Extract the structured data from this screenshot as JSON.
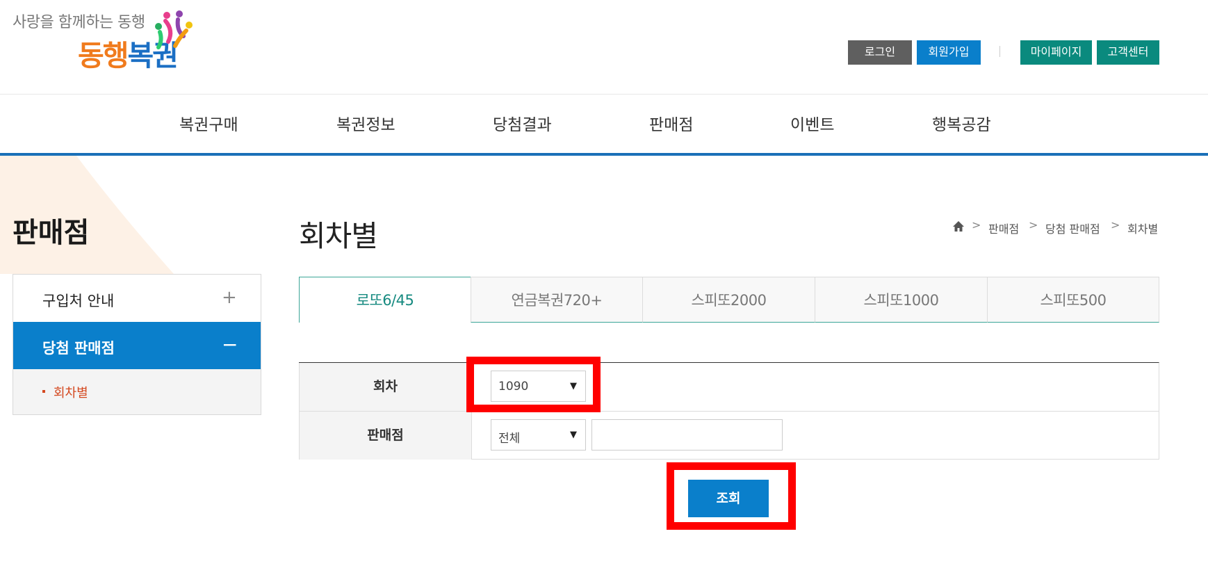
{
  "header": {
    "logo": {
      "slogan": "사랑을 함께하는 동행",
      "name_part1": "동행",
      "name_part2": "복권"
    },
    "buttons": {
      "login": "로그인",
      "join": "회원가입",
      "mypage": "마이페이지",
      "customer_center": "고객센터"
    }
  },
  "gnb": [
    "복권구매",
    "복권정보",
    "당첨결과",
    "판매점",
    "이벤트",
    "행복공감"
  ],
  "lnb": {
    "title": "판매점",
    "items": [
      {
        "label": "구입처 안내",
        "icon": "plus-icon",
        "toggle": "+"
      },
      {
        "label": "당첨 판매점",
        "icon": "minus-icon",
        "toggle": "−",
        "active": true
      }
    ],
    "sub_items": [
      {
        "label": "회차별",
        "active": true
      }
    ]
  },
  "content": {
    "title": "회차별",
    "breadcrumb": [
      "판매점",
      "당첨 판매점",
      "회차별"
    ],
    "breadcrumb_sep": ">",
    "tabs": [
      {
        "label": "로또6/45",
        "active": true
      },
      {
        "label": "연금복권720+"
      },
      {
        "label": "스피또2000"
      },
      {
        "label": "스피또1000"
      },
      {
        "label": "스피또500"
      }
    ],
    "form": {
      "round_label": "회차",
      "round_value": "1090",
      "store_label": "판매점",
      "store_select_value": "전체",
      "store_input_value": "",
      "select_arrow": "▼"
    },
    "search_button": "조회"
  },
  "colors": {
    "primary_blue": "#0a7fcb",
    "teal": "#0a8a7e",
    "tab_active": "#168a80",
    "highlight": "#ff0000",
    "sub_active": "#d4481f"
  }
}
